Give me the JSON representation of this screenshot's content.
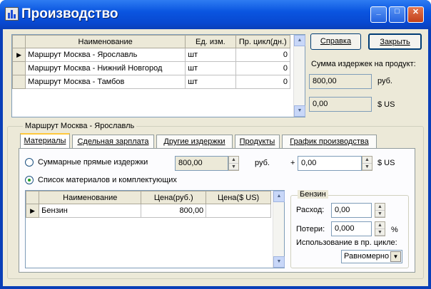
{
  "window": {
    "title": "Производство"
  },
  "titlebar": {
    "minimize": "_",
    "maximize": "□",
    "close": "✕"
  },
  "routes_table": {
    "columns": [
      "Наименование",
      "Ед. изм.",
      "Пр. цикл(дн.)"
    ],
    "rows": [
      {
        "name": "Маршрут Москва - Ярославль",
        "unit": "шт",
        "cycle": "0"
      },
      {
        "name": "Маршрут Москва - Нижний Новгород",
        "unit": "шт",
        "cycle": "0"
      },
      {
        "name": "Маршрут Москва - Тамбов",
        "unit": "шт",
        "cycle": "0"
      }
    ],
    "current_marker": "▶"
  },
  "buttons": {
    "help": "Справка",
    "close": "Закрыть"
  },
  "summary": {
    "label": "Сумма издержек на продукт:",
    "rub_value": "800,00",
    "rub_unit": "руб.",
    "usd_value": "0,00",
    "usd_unit": "$ US"
  },
  "details": {
    "group_title": "Маршрут Москва - Ярославль",
    "tabs": [
      "Материалы",
      "Сдельная зарплата",
      "Другие издержки",
      "Продукты",
      "График производства"
    ],
    "active_tab": "Материалы",
    "radio_sum_label": "Суммарные прямые издержки",
    "sum_value": "800,00",
    "sum_unit": "руб.",
    "plus": "+",
    "usd_value": "0,00",
    "usd_unit": "$ US",
    "radio_list_label": "Список материалов и комплектующих",
    "materials": {
      "columns": [
        "Наименование",
        "Цена(руб.)",
        "Цена($ US)"
      ],
      "rows": [
        {
          "name": "Бензин",
          "price_rub": "800,00",
          "price_usd": ""
        }
      ]
    },
    "item_group": {
      "title": "Бензин",
      "consumption_label": "Расход:",
      "consumption_value": "0,00",
      "losses_label": "Потери:",
      "losses_value": "0,000",
      "losses_unit": "%",
      "usage_label": "Использование в пр. цикле:",
      "usage_value": "Равномерно"
    }
  }
}
